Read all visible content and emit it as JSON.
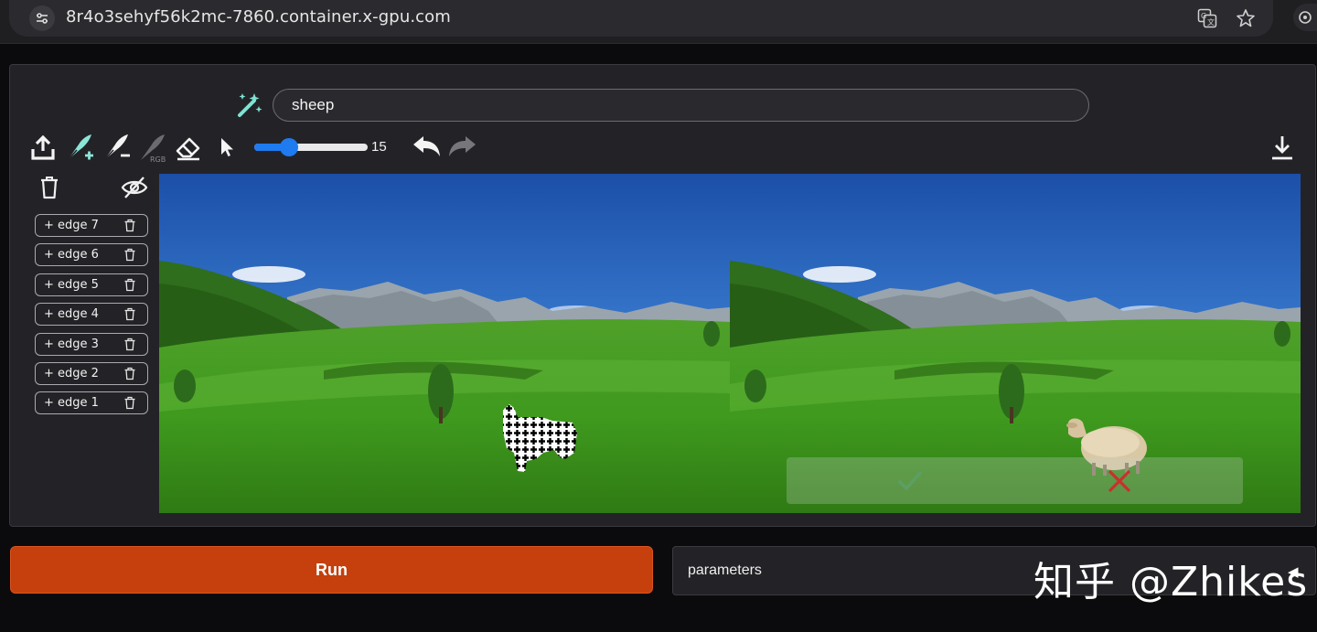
{
  "browser": {
    "url": "8r4o3sehyf56k2mc-7860.container.x-gpu.com"
  },
  "prompt": {
    "value": "sheep"
  },
  "toolbar": {
    "brush_size": "15",
    "brush_fraction": 0.3
  },
  "layers": [
    {
      "label": "+ edge 7"
    },
    {
      "label": "+ edge 6"
    },
    {
      "label": "+ edge 5"
    },
    {
      "label": "+ edge 4"
    },
    {
      "label": "+ edge 3"
    },
    {
      "label": "+ edge 2"
    },
    {
      "label": "+ edge 1"
    }
  ],
  "actions": {
    "run_label": "Run",
    "parameters_label": "parameters"
  },
  "watermark": {
    "text": "知乎 @Zhikes"
  },
  "colors": {
    "accent": "#c5400d",
    "slider": "#1e7bf0",
    "magic_icon": "#7fe3d3",
    "confirm_check": "#5aa06a",
    "reject_cross": "#c9302c"
  }
}
